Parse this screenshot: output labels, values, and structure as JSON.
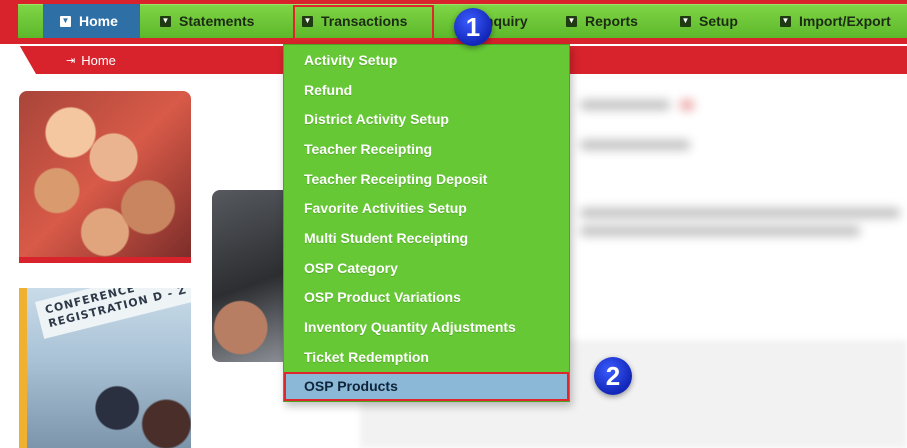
{
  "menu": {
    "items": [
      {
        "label": "Home",
        "active": true
      },
      {
        "label": "Statements"
      },
      {
        "label": "Transactions"
      },
      {
        "label": "Inquiry"
      },
      {
        "label": "Reports"
      },
      {
        "label": "Setup"
      },
      {
        "label": "Import/Export"
      }
    ]
  },
  "breadcrumb": {
    "home_label": "Home"
  },
  "dropdown": {
    "items": [
      {
        "label": "Activity Setup"
      },
      {
        "label": "Refund"
      },
      {
        "label": "District Activity Setup"
      },
      {
        "label": "Teacher Receipting"
      },
      {
        "label": "Teacher Receipting Deposit"
      },
      {
        "label": "Favorite Activities Setup"
      },
      {
        "label": "Multi Student Receipting"
      },
      {
        "label": "OSP Category"
      },
      {
        "label": "OSP Product Variations"
      },
      {
        "label": "Inventory Quantity Adjustments"
      },
      {
        "label": "Ticket Redemption"
      },
      {
        "label": "OSP Products",
        "selected": true
      }
    ]
  },
  "annotations": {
    "step1": "1",
    "step2": "2"
  },
  "images": {
    "conference_sign": "CONFERENCE REGISTRATION D - Z"
  },
  "colors": {
    "menu_green": "#66c834",
    "brand_red": "#d8232c",
    "active_tab_blue": "#2e6fa6",
    "selected_item_blue": "#8ab8d6",
    "step_marker_blue": "#1a35d6",
    "highlight_red": "#e0262d"
  }
}
